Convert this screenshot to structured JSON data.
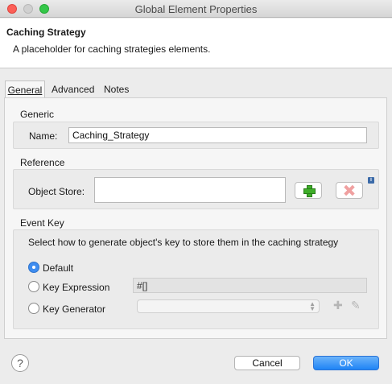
{
  "window": {
    "title": "Global Element Properties"
  },
  "header": {
    "title": "Caching Strategy",
    "description": "A placeholder for caching strategies elements."
  },
  "tabs": [
    {
      "label": "General",
      "active": true
    },
    {
      "label": "Advanced",
      "active": false
    },
    {
      "label": "Notes",
      "active": false
    }
  ],
  "generic": {
    "group_label": "Generic",
    "name_label": "Name:",
    "name_value": "Caching_Strategy"
  },
  "reference": {
    "group_label": "Reference",
    "object_store_label": "Object Store:",
    "object_store_value": "",
    "info_glyph": "i"
  },
  "event_key": {
    "group_label": "Event Key",
    "description": "Select how to generate object's key to store them in the caching strategy",
    "options": [
      {
        "label": "Default",
        "selected": true
      },
      {
        "label": "Key Expression",
        "selected": false
      },
      {
        "label": "Key Generator",
        "selected": false
      }
    ],
    "key_expression_value": "#[]",
    "key_generator_value": ""
  },
  "footer": {
    "help_glyph": "?",
    "cancel_label": "Cancel",
    "ok_label": "OK"
  },
  "colors": {
    "accent_blue": "#1f84f5",
    "add_green": "#3fae29",
    "remove_red": "#f0a0a0"
  }
}
